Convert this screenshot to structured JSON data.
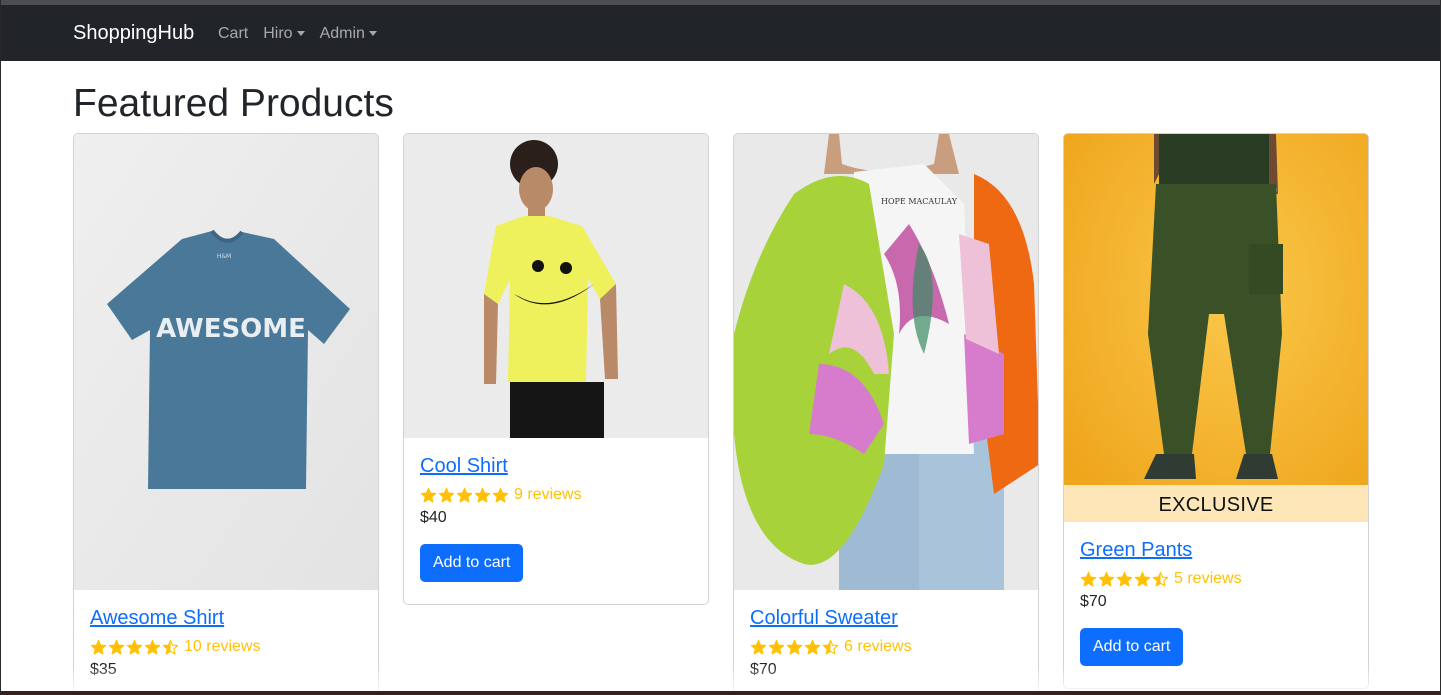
{
  "nav": {
    "brand": "ShoppingHub",
    "links": [
      {
        "label": "Cart"
      },
      {
        "label": "Hiro"
      },
      {
        "label": "Admin"
      }
    ]
  },
  "page": {
    "title": "Featured Products"
  },
  "products": [
    {
      "name": "Awesome Shirt",
      "rating": 4.5,
      "reviews": "10 reviews",
      "price": "$35",
      "shirt_text": "AWESOME",
      "tag_text": "H&M"
    },
    {
      "name": "Cool Shirt",
      "rating": 5,
      "reviews": "9 reviews",
      "price": "$40",
      "button": "Add to cart"
    },
    {
      "name": "Colorful Sweater",
      "rating": 4.5,
      "reviews": "6 reviews",
      "price": "$70",
      "print_text": "HOPE MACAULAY"
    },
    {
      "name": "Green Pants",
      "rating": 4.5,
      "reviews": "5 reviews",
      "price": "$70",
      "button": "Add to cart",
      "badge": "EXCLUSIVE"
    }
  ],
  "colors": {
    "navbar": "#212529",
    "link": "#0d6efd",
    "star": "#ffc107",
    "button": "#0d6efd"
  }
}
